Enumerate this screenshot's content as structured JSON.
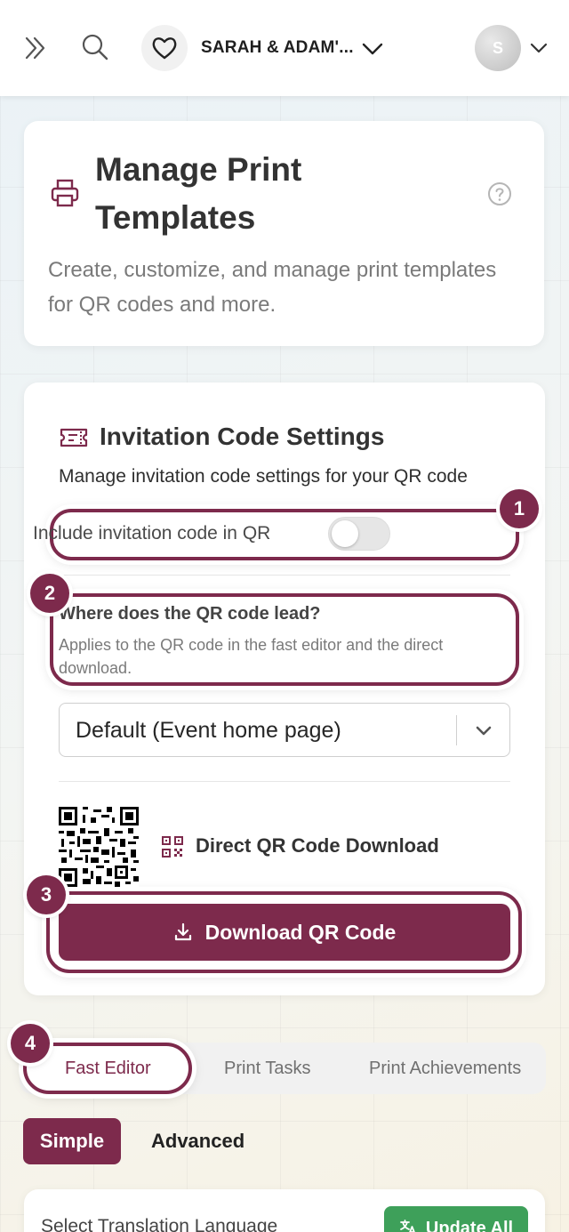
{
  "header": {
    "event_name": "SARAH & ADAM'...",
    "avatar_initial": "S",
    "icons": [
      "double-chevron-right-icon",
      "search-icon",
      "heart-icon",
      "chevron-down-icon",
      "chevron-down-icon"
    ]
  },
  "intro": {
    "title": "Manage Print Templates",
    "subtitle": "Create, customize, and manage print templates for QR codes and more.",
    "icons": [
      "printer-icon",
      "help-icon"
    ]
  },
  "invitation": {
    "title": "Invitation Code Settings",
    "subtitle": "Manage invitation code settings for your QR code",
    "include_label": "Include invitation code in QR",
    "include_enabled": false,
    "where_title": "Where does the QR code lead?",
    "where_sub": "Applies to the QR code in the fast editor and the direct download.",
    "lead_selected": "Default (Event home page)",
    "direct_title": "Direct QR Code Download",
    "download_label": "Download QR Code"
  },
  "badges": [
    "1",
    "2",
    "3",
    "4"
  ],
  "tabs": {
    "fast": "Fast Editor",
    "tasks": "Print Tasks",
    "achievements": "Print Achievements",
    "active": "Fast Editor"
  },
  "modes": {
    "simple": "Simple",
    "advanced": "Advanced",
    "active": "Simple"
  },
  "translation": {
    "label": "Select Translation Language",
    "update_label": "Update All"
  },
  "colors": {
    "accent": "#7d2a4c",
    "success": "#3ea05a"
  }
}
